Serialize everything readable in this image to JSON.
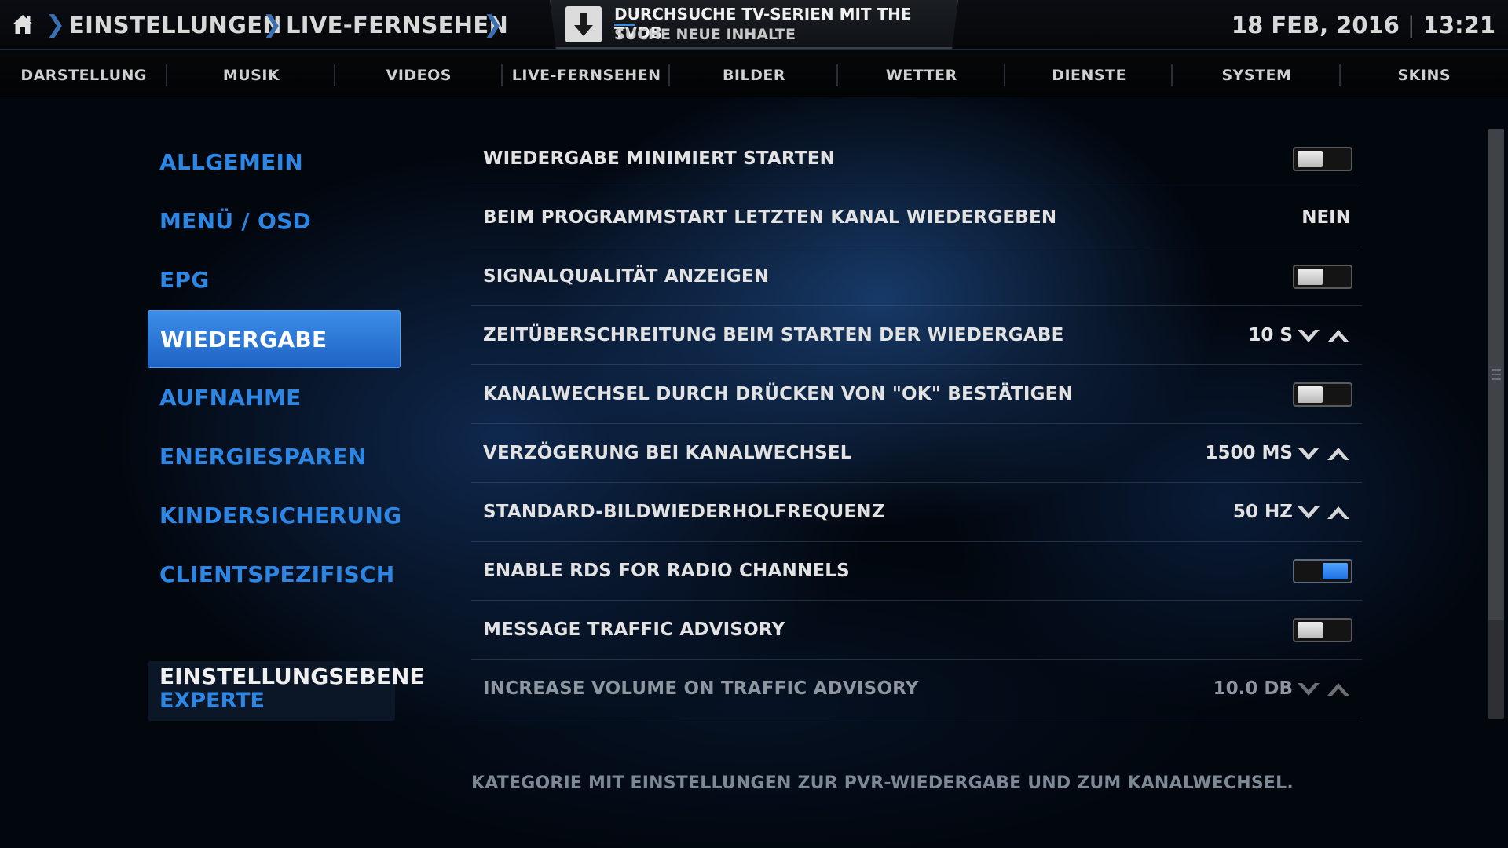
{
  "breadcrumb": {
    "items": [
      "EINSTELLUNGEN",
      "LIVE-FERNSEHEN"
    ],
    "separator": "❯"
  },
  "notification": {
    "title": "DURCHSUCHE TV-SERIEN MIT THE TVDB",
    "subtitle": "SUCHE NEUE INHALTE",
    "progress": 0.07,
    "icon": "download-arrow-icon"
  },
  "clock": {
    "date": "18 FEB, 2016",
    "separator": "|",
    "time": "13:21"
  },
  "categories": [
    "DARSTELLUNG",
    "MUSIK",
    "VIDEOS",
    "LIVE-FERNSEHEN",
    "BILDER",
    "WETTER",
    "DIENSTE",
    "SYSTEM",
    "SKINS"
  ],
  "sidemenu": {
    "items": [
      {
        "label": "ALLGEMEIN",
        "active": false
      },
      {
        "label": "MENÜ / OSD",
        "active": false
      },
      {
        "label": "EPG",
        "active": false
      },
      {
        "label": "WIEDERGABE",
        "active": true
      },
      {
        "label": "AUFNAHME",
        "active": false
      },
      {
        "label": "ENERGIESPAREN",
        "active": false
      },
      {
        "label": "KINDERSICHERUNG",
        "active": false
      },
      {
        "label": "CLIENTSPEZIFISCH",
        "active": false
      }
    ],
    "level_title": "EINSTELLUNGSEBENE",
    "level_value": "EXPERTE"
  },
  "settings": [
    {
      "label": "WIEDERGABE MINIMIERT STARTEN",
      "type": "toggle",
      "on": false
    },
    {
      "label": "BEIM PROGRAMMSTART LETZTEN KANAL WIEDERGEBEN",
      "type": "value",
      "value": "NEIN"
    },
    {
      "label": "SIGNALQUALITÄT ANZEIGEN",
      "type": "toggle",
      "on": false
    },
    {
      "label": "ZEITÜBERSCHREITUNG BEIM STARTEN DER WIEDERGABE",
      "type": "spin",
      "value": "10 S"
    },
    {
      "label": "KANALWECHSEL DURCH DRÜCKEN VON \"OK\" BESTÄTIGEN",
      "type": "toggle",
      "on": false
    },
    {
      "label": "VERZÖGERUNG BEI KANALWECHSEL",
      "type": "spin",
      "value": "1500 MS"
    },
    {
      "label": "STANDARD-BILDWIEDERHOLFREQUENZ",
      "type": "spin",
      "value": "50 HZ"
    },
    {
      "label": "ENABLE RDS FOR RADIO CHANNELS",
      "type": "toggle",
      "on": true
    },
    {
      "label": "MESSAGE TRAFFIC ADVISORY",
      "type": "toggle",
      "on": false
    },
    {
      "label": "INCREASE VOLUME ON TRAFFIC ADVISORY",
      "type": "spin",
      "value": "10.0 DB",
      "disabled": true
    }
  ],
  "description": "KATEGORIE MIT EINSTELLUNGEN ZUR PVR-WIEDERGABE UND ZUM KANALWECHSEL.",
  "colors": {
    "accent": "#2e86e4",
    "toggle_on": "#3a8ce0"
  }
}
